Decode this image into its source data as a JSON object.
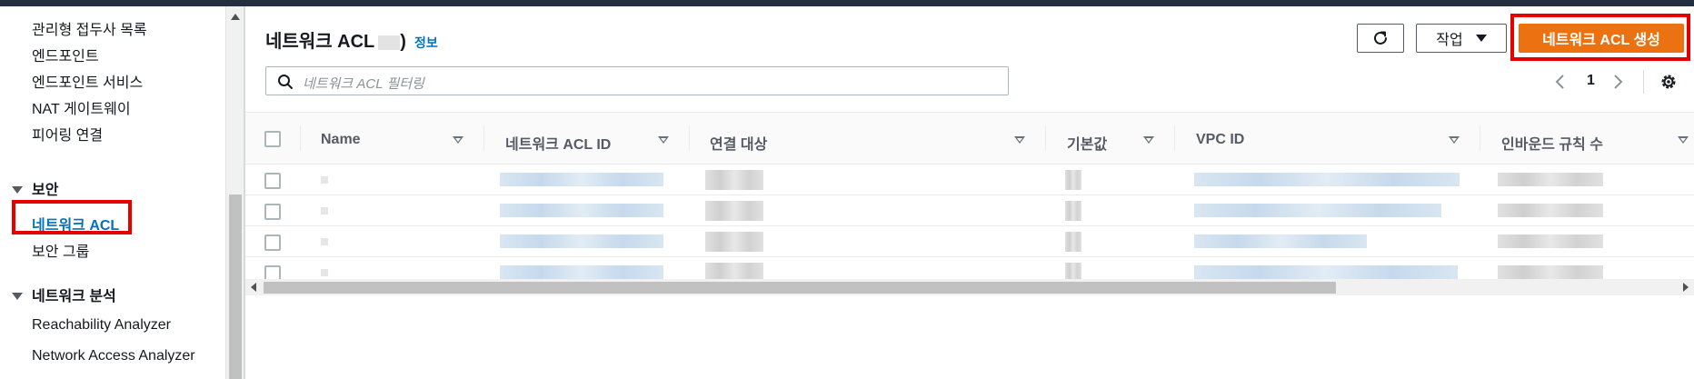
{
  "colors": {
    "accent": "#ec7211",
    "link": "#0073bb",
    "highlight": "#e60000",
    "topbar": "#232f3e"
  },
  "sidebar": {
    "items": [
      {
        "label": "관리형 접두사 목록"
      },
      {
        "label": "엔드포인트"
      },
      {
        "label": "엔드포인트 서비스"
      },
      {
        "label": "NAT 게이트웨이"
      },
      {
        "label": "피어링 연결"
      }
    ],
    "security": {
      "title": "보안",
      "items": [
        {
          "label": "네트워크 ACL"
        },
        {
          "label": "보안 그룹"
        }
      ]
    },
    "analysis": {
      "title": "네트워크 분석",
      "items": [
        {
          "label": "Reachability Analyzer"
        },
        {
          "label": "Network Access Analyzer"
        }
      ]
    }
  },
  "header": {
    "title": "네트워크 ACL",
    "title_suffix": ")",
    "info": "정보",
    "actions_label": "작업",
    "create_label": "네트워크 ACL 생성"
  },
  "search": {
    "placeholder": "네트워크 ACL 필터링"
  },
  "pagination": {
    "current_page": "1"
  },
  "table": {
    "columns": [
      "Name",
      "네트워크 ACL ID",
      "연결 대상",
      "기본값",
      "VPC ID",
      "인바운드 규칙 수"
    ],
    "row_count": 4
  },
  "icons": [
    "refresh-icon",
    "search-icon",
    "chevron-left-icon",
    "chevron-right-icon",
    "gear-icon",
    "caret-down-icon",
    "sort-icon"
  ]
}
